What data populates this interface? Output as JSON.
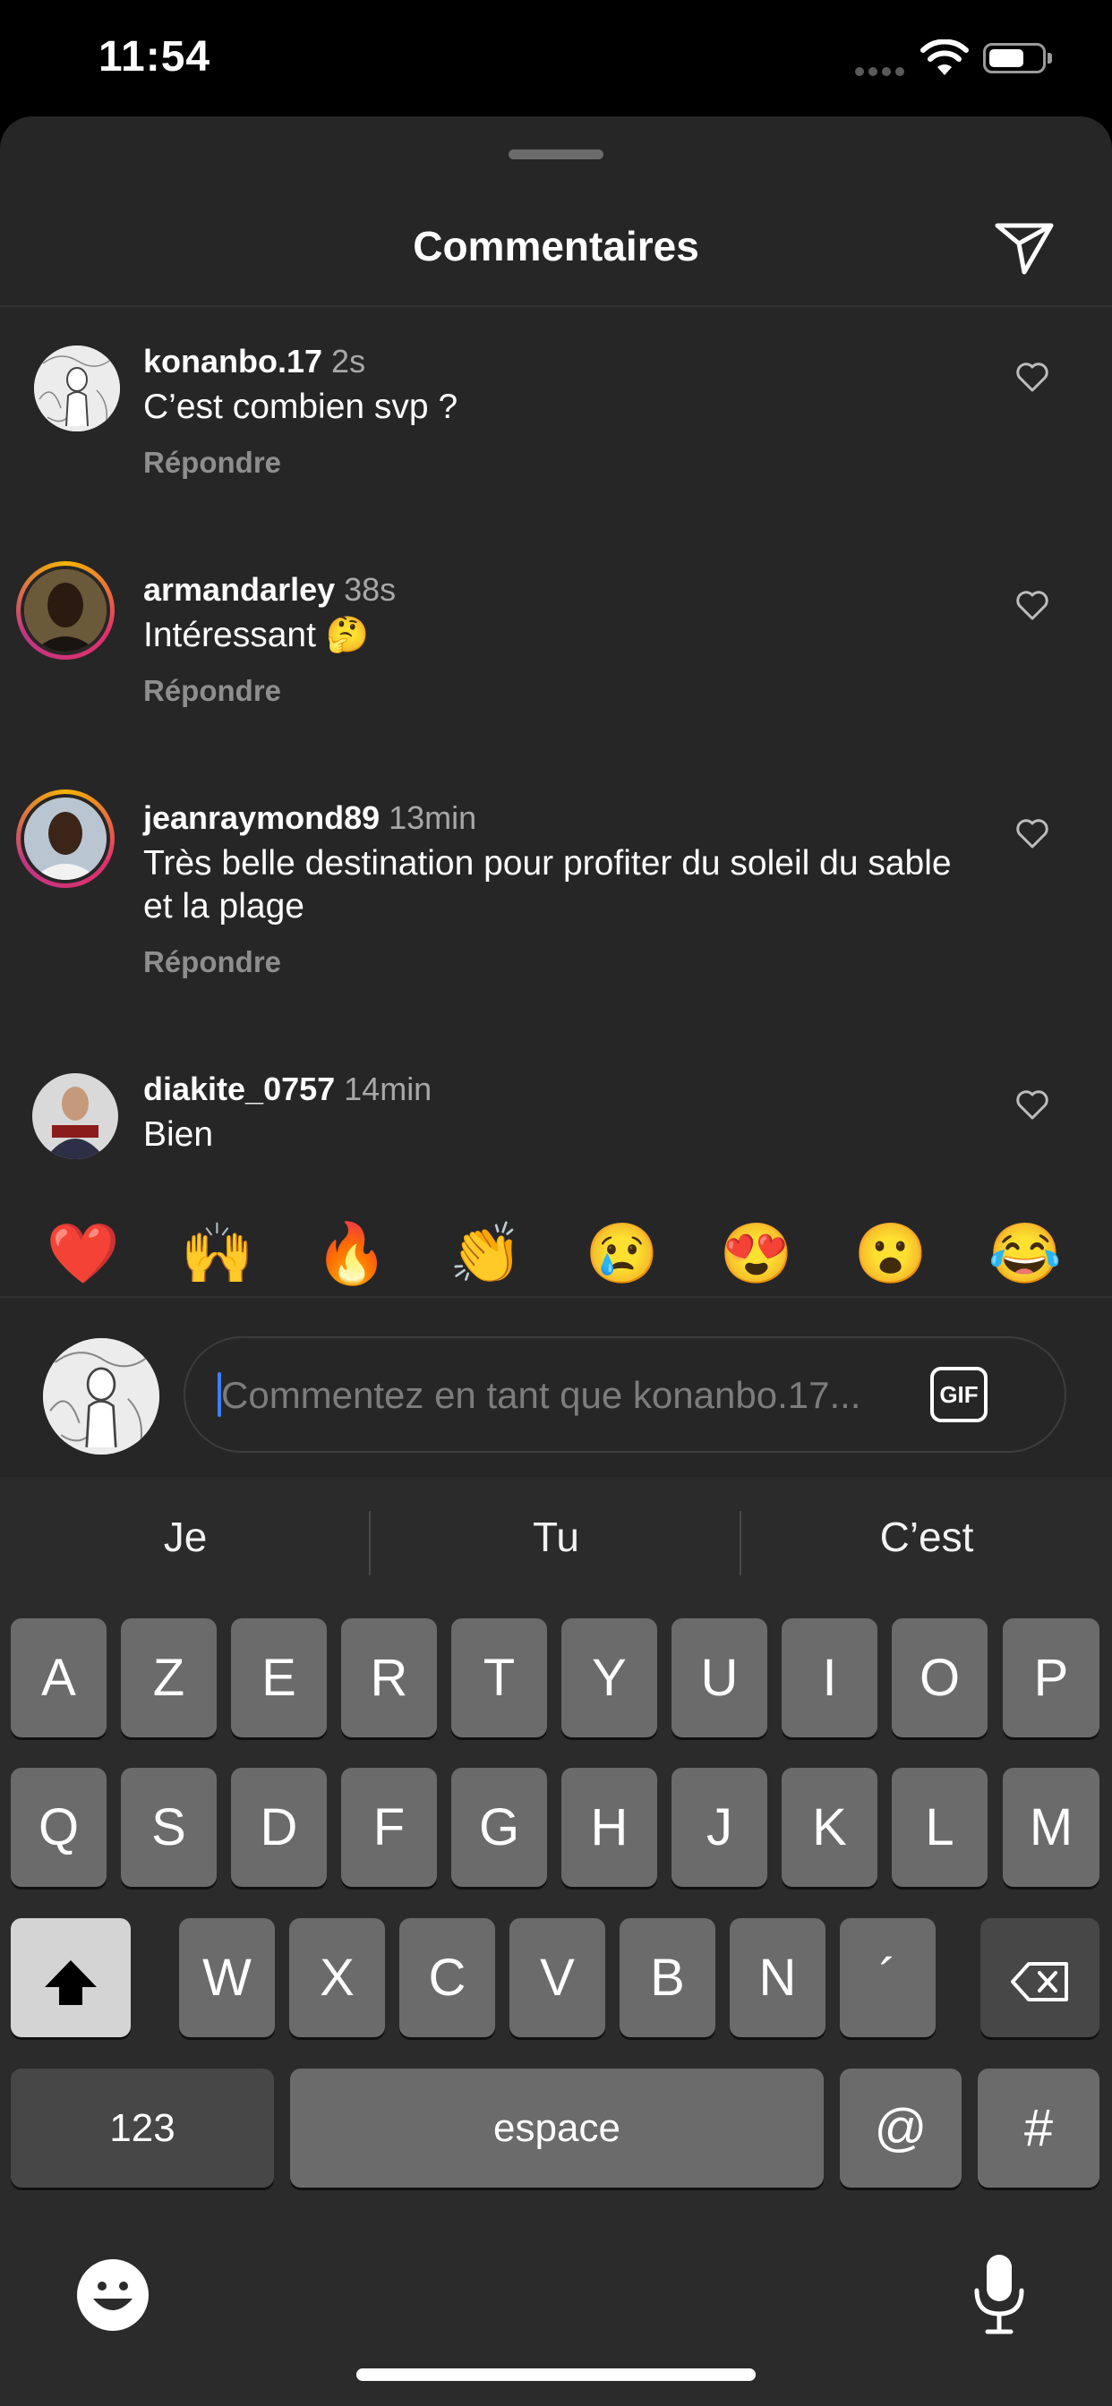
{
  "status_bar": {
    "time": "11:54"
  },
  "header": {
    "title": "Commentaires"
  },
  "comments": [
    {
      "username": "konanbo.17",
      "time": "2s",
      "text": "C’est combien svp ?",
      "reply": "Répondre"
    },
    {
      "username": "armandarley",
      "time": "38s",
      "text": "Intéressant 🤔",
      "reply": "Répondre"
    },
    {
      "username": "jeanraymond89",
      "time": "13min",
      "text": "Très belle destination pour profiter du soleil du sable et la plage",
      "reply": "Répondre"
    },
    {
      "username": "diakite_0757",
      "time": "14min",
      "text": "Bien",
      "reply": ""
    }
  ],
  "emoji_bar": [
    "❤️",
    "🙌",
    "🔥",
    "👏",
    "😢",
    "😍",
    "😮",
    "😂"
  ],
  "composer": {
    "placeholder": "Commentez en tant que konanbo.17...",
    "gif_label": "GIF"
  },
  "keyboard": {
    "suggestions": [
      "Je",
      "Tu",
      "C’est"
    ],
    "row1": [
      "A",
      "Z",
      "E",
      "R",
      "T",
      "Y",
      "U",
      "I",
      "O",
      "P"
    ],
    "row2": [
      "Q",
      "S",
      "D",
      "F",
      "G",
      "H",
      "J",
      "K",
      "L",
      "M"
    ],
    "row3": [
      "W",
      "X",
      "C",
      "V",
      "B",
      "N",
      "´"
    ],
    "numbers_label": "123",
    "space_label": "espace",
    "at_label": "@",
    "hash_label": "#"
  }
}
